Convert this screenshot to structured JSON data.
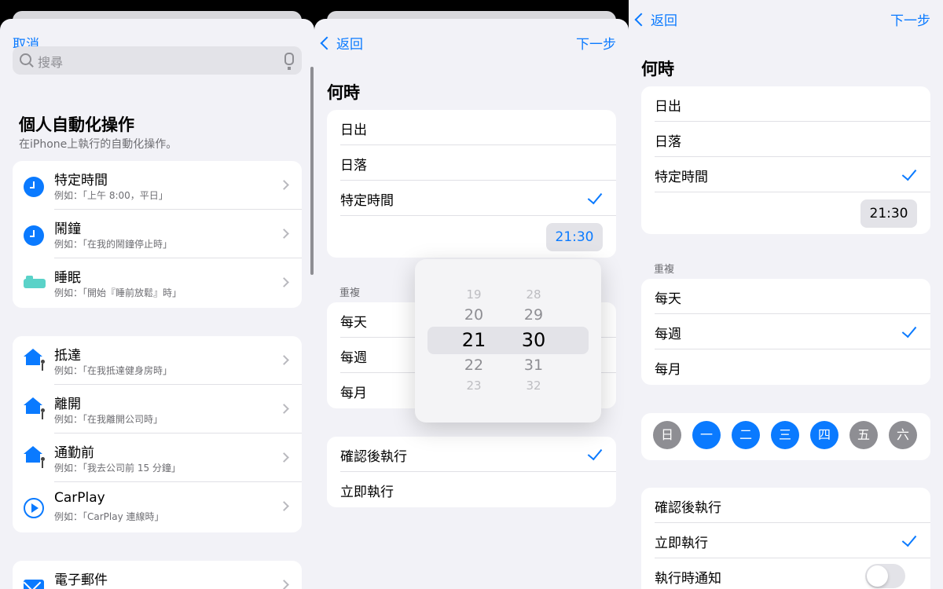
{
  "colors": {
    "accent": "#0a7aff",
    "day_selected": "#0a7aff",
    "day_unselected": "#8e8e93"
  },
  "panel1": {
    "cancel": "取消",
    "search_placeholder": "搜尋",
    "title": "個人自動化操作",
    "subtitle": "在iPhone上執行的自動化操作。",
    "group1": [
      {
        "title": "特定時間",
        "desc": "例如：「上午 8:00，平日」",
        "icon": "clock-icon"
      },
      {
        "title": "鬧鐘",
        "desc": "例如：「在我的鬧鐘停止時」",
        "icon": "clock-icon"
      },
      {
        "title": "睡眠",
        "desc": "例如：「開始『睡前放鬆』時」",
        "icon": "bed-icon"
      }
    ],
    "group2": [
      {
        "title": "抵達",
        "desc": "例如：「在我抵達健身房時」",
        "icon": "house-walker-icon"
      },
      {
        "title": "離開",
        "desc": "例如：「在我離開公司時」",
        "icon": "house-walker-icon"
      },
      {
        "title": "通勤前",
        "desc": "例如：「我去公司前 15 分鐘」",
        "icon": "house-walker-icon"
      },
      {
        "title": "CarPlay",
        "desc": "例如：「CarPlay 連線時」",
        "icon": "carplay-icon"
      }
    ],
    "group3": [
      {
        "title": "電子郵件",
        "icon": "mail-icon"
      }
    ]
  },
  "panel2": {
    "back": "返回",
    "next": "下一步",
    "when": "何時",
    "options": [
      "日出",
      "日落",
      "特定時間"
    ],
    "selected_option": "特定時間",
    "time": "21:30",
    "repeat_label": "重複",
    "repeat": [
      "每天",
      "每週",
      "每月"
    ],
    "run": [
      "確認後執行",
      "立即執行"
    ],
    "picker": {
      "hours": [
        "19",
        "20",
        "21",
        "22",
        "23"
      ],
      "minutes": [
        "28",
        "29",
        "30",
        "31",
        "32"
      ],
      "selected_hour": "21",
      "selected_minute": "30"
    }
  },
  "panel3": {
    "back": "返回",
    "next": "下一步",
    "when": "何時",
    "options": [
      "日出",
      "日落",
      "特定時間"
    ],
    "time": "21:30",
    "repeat_label": "重複",
    "repeat": [
      "每天",
      "每週",
      "每月"
    ],
    "days": [
      {
        "label": "日",
        "selected": false
      },
      {
        "label": "一",
        "selected": true
      },
      {
        "label": "二",
        "selected": true
      },
      {
        "label": "三",
        "selected": true
      },
      {
        "label": "四",
        "selected": true
      },
      {
        "label": "五",
        "selected": false
      },
      {
        "label": "六",
        "selected": false
      }
    ],
    "run": [
      "確認後執行",
      "立即執行"
    ],
    "notify": "執行時通知",
    "notify_on": false
  }
}
